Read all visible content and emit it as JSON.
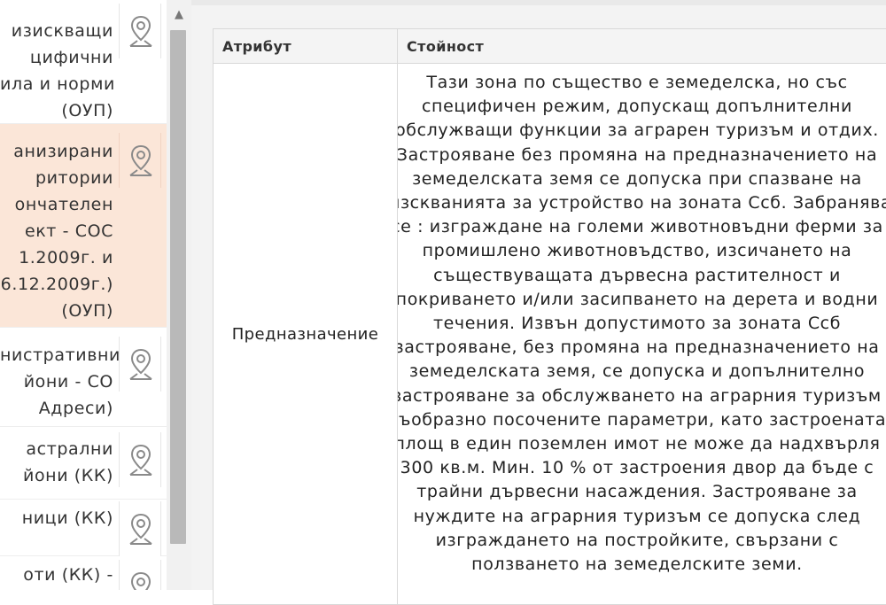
{
  "sidebar": {
    "layers": [
      {
        "lines": [
          "изискващи",
          "цифични",
          "ила и норми",
          "(ОУП)"
        ],
        "active": false,
        "icon": "map-pin-icon"
      },
      {
        "lines": [
          "анизирани",
          "ритории",
          "ончателен",
          "ект - СОС",
          "1.2009г. и",
          "6.12.2009г.)",
          "(ОУП)"
        ],
        "active": true,
        "icon": "map-pin-icon"
      },
      {
        "lines": [
          "нистративни",
          "йони - СО",
          "Адреси)"
        ],
        "active": false,
        "icon": "map-pin-icon"
      },
      {
        "lines": [
          "астрални",
          "йони (КК)"
        ],
        "active": false,
        "icon": "map-pin-icon"
      },
      {
        "lines": [
          "ници (КК)"
        ],
        "active": false,
        "icon": "map-pin-icon"
      },
      {
        "lines": [
          "оти (КК) -"
        ],
        "active": false,
        "icon": "map-pin-icon"
      }
    ]
  },
  "table": {
    "headers": [
      "Атрибут",
      "Стойност"
    ],
    "rows": [
      {
        "attribute": "Предназначение",
        "value_lines": [
          "Тази зона по същество е земеделска, но със",
          "специфичен режим, допускащ допълнителни",
          "обслужващи функции за аграрен туризъм и отдих.",
          "Застрояване без промяна на предназначението на",
          "земеделската земя се допуска при спазване на",
          "изскванията за устройство на зоната Ссб. Забранява",
          "се : изграждане на големи животновъдни ферми за",
          "промишлено животновъдство, изсичането на",
          "съществуващата дървесна растителност и",
          "покриването и/или засипването на дерета и водни",
          "течения. Извън допустимото за зоната Ссб",
          "застрояване, без промяна на предназначението на",
          "земеделската земя, се допуска и допълнително",
          "застрояване за обслужването на аграрния туризъм",
          "съобразно посочените параметри, като застроената",
          "площ в един поземлен имот не може да надхвърля",
          "300 кв.м. Мин. 10 % от застроения двор да бъде с",
          "трайни дървесни насаждения. Застрояване за",
          "нуждите на аграрния туризъм се допуска след",
          "изграждането на постройките, свързани с",
          "ползването на земеделските земи."
        ]
      }
    ]
  },
  "colors": {
    "active_row_bg": "#fbe6d8",
    "header_bg": "#f4f4f4",
    "border": "#d9d9d9",
    "scroll_thumb": "#b9b9b9"
  }
}
